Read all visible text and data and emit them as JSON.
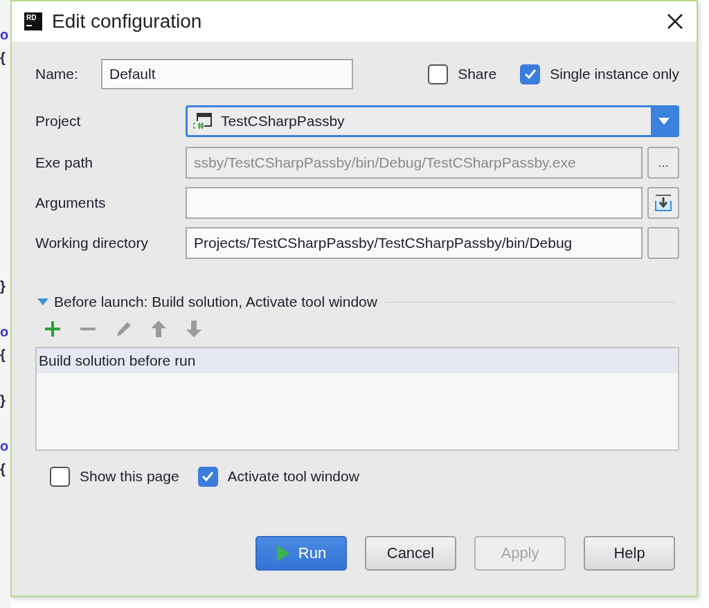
{
  "editor_fragments": [
    "o",
    "{",
    "}",
    "o",
    "{",
    "}",
    "o",
    "{"
  ],
  "window": {
    "app_icon_text": "RD",
    "title": "Edit configuration"
  },
  "name_field": {
    "label": "Name:",
    "value": "Default"
  },
  "options": [
    {
      "label": "Share",
      "checked": false
    },
    {
      "label": "Single instance only",
      "checked": true
    }
  ],
  "fields": [
    {
      "kind": "combo",
      "label": "Project",
      "value": "TestCSharpPassby",
      "focused": true
    },
    {
      "kind": "text",
      "label": "Exe path",
      "value": "ssby/TestCSharpPassby/bin/Debug/TestCSharpPassby.exe",
      "disabled": true,
      "button": {
        "kind": "text",
        "text": "..."
      }
    },
    {
      "kind": "text",
      "label": "Arguments",
      "disabled": false,
      "button": {
        "kind": "icon"
      }
    },
    {
      "kind": "text",
      "label": "Working directory",
      "value": "Projects/TestCSharpPassby/TestCSharpPassby/bin/Debug",
      "disabled": false,
      "button": {
        "kind": "plain"
      }
    }
  ],
  "before_launch": {
    "title": "Before launch: Build solution, Activate tool window",
    "expanded": true,
    "tools": [
      {
        "kind": "add",
        "disabled": false
      },
      {
        "kind": "remove",
        "disabled": true
      },
      {
        "kind": "edit",
        "disabled": true
      },
      {
        "kind": "up",
        "disabled": true
      },
      {
        "kind": "down",
        "disabled": true
      }
    ],
    "tasks": [
      {
        "label": "Build solution before run",
        "selected": true
      }
    ]
  },
  "bottom_options": [
    {
      "label": "Show this page",
      "checked": false
    },
    {
      "label": "Activate tool window",
      "checked": true
    }
  ],
  "buttons": [
    {
      "kind": "primary",
      "label": "Run",
      "disabled": false
    },
    {
      "kind": "normal",
      "label": "Cancel",
      "disabled": false
    },
    {
      "kind": "normal",
      "label": "Apply",
      "disabled": true
    },
    {
      "kind": "normal",
      "label": "Help",
      "disabled": false
    }
  ]
}
